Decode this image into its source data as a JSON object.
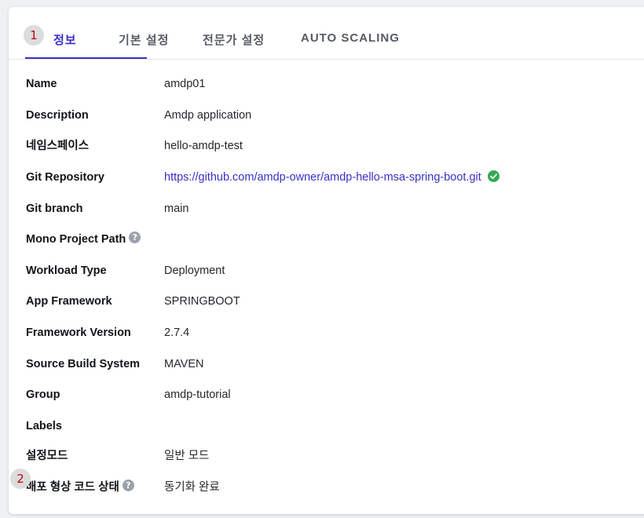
{
  "tabs": [
    {
      "label": "정보"
    },
    {
      "label": "기본 설정"
    },
    {
      "label": "전문가 설정"
    },
    {
      "label": "AUTO SCALING"
    }
  ],
  "markers": [
    "1",
    "2"
  ],
  "details": [
    {
      "label": "Name",
      "value": "amdp01"
    },
    {
      "label": "Description",
      "value": "Amdp application"
    },
    {
      "label": "네임스페이스",
      "value": "hello-amdp-test"
    },
    {
      "label": "Git Repository",
      "value": "https://github.com/amdp-owner/amdp-hello-msa-spring-boot.git"
    },
    {
      "label": "Git branch",
      "value": "main"
    },
    {
      "label": "Mono Project Path",
      "value": ""
    },
    {
      "label": "Workload Type",
      "value": "Deployment"
    },
    {
      "label": "App Framework",
      "value": "SPRINGBOOT"
    },
    {
      "label": "Framework Version",
      "value": "2.7.4"
    },
    {
      "label": "Source Build System",
      "value": "MAVEN"
    },
    {
      "label": "Group",
      "value": "amdp-tutorial"
    },
    {
      "label": "Labels",
      "value": ""
    },
    {
      "label": "설정모드",
      "value": "일반 모드"
    },
    {
      "label": "배포 형상 코드 상태",
      "value": "동기화 완료"
    }
  ],
  "icons": {
    "help": "question-circle-icon",
    "repo_status": "check-circle-icon"
  },
  "help_glyph": "?",
  "colors": {
    "accent": "#3a2fc8",
    "success": "#34a853",
    "marker_text": "#c0001a"
  }
}
